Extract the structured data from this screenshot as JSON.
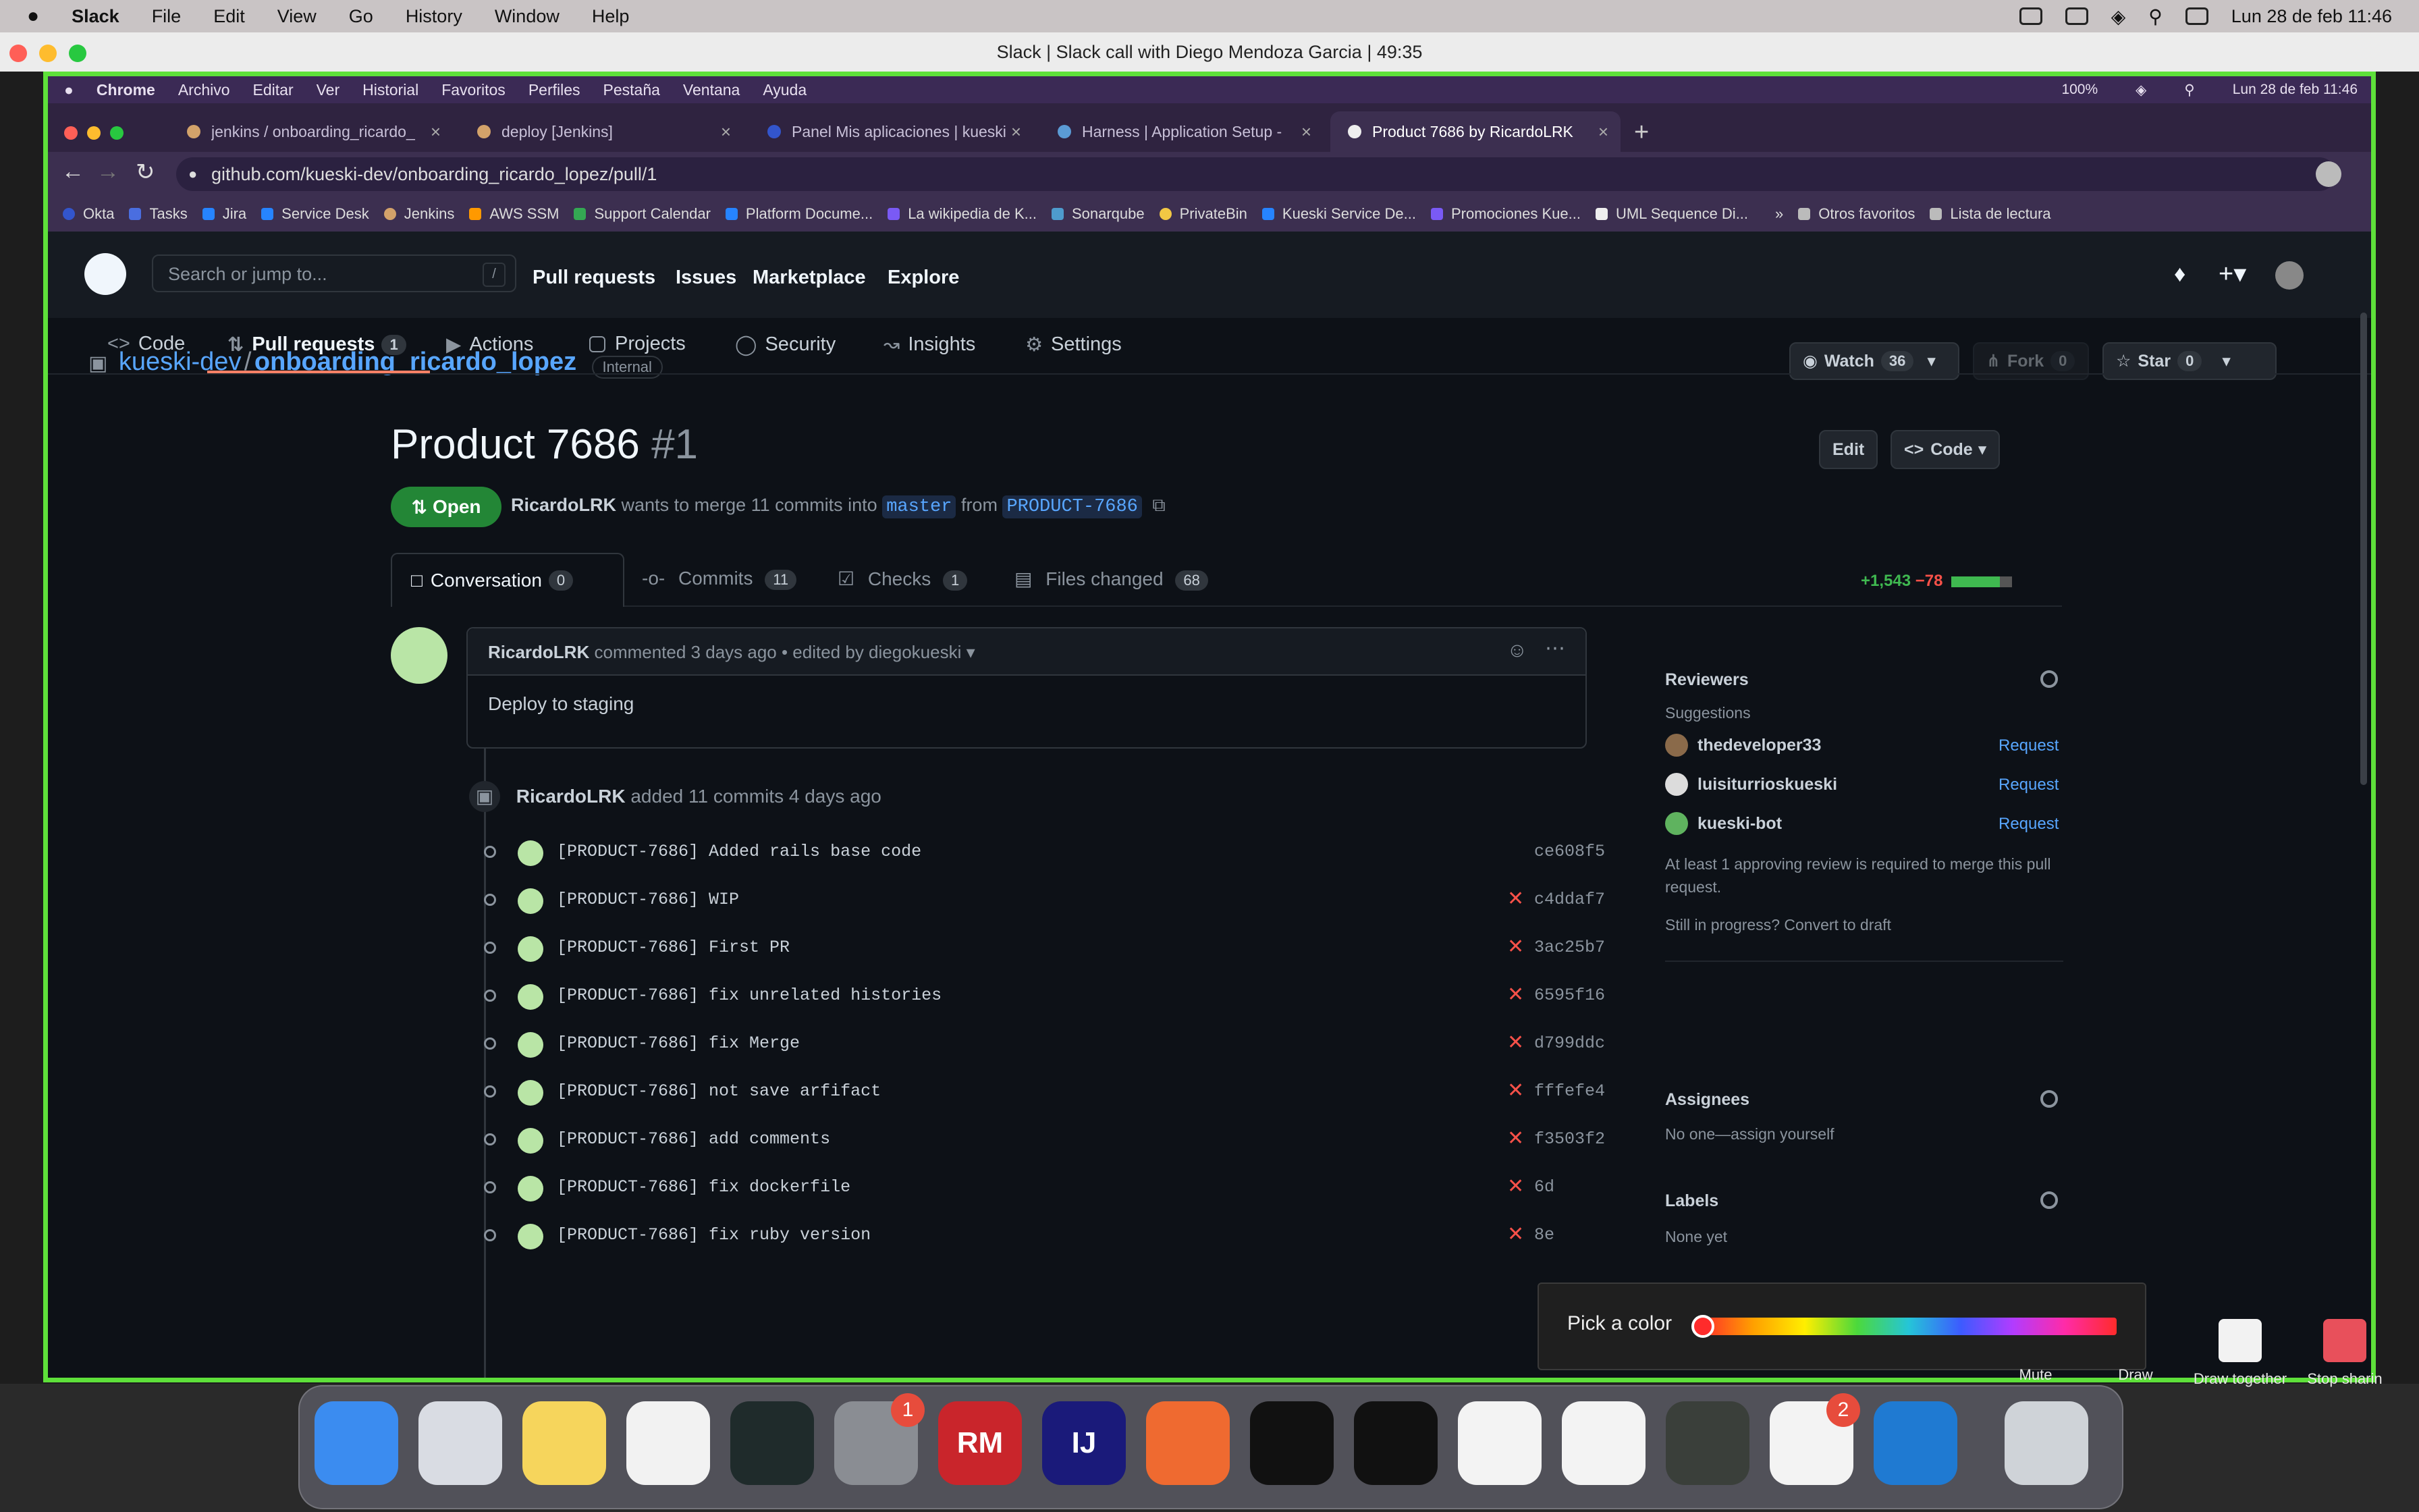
{
  "menubar": {
    "apple": "",
    "app": "Slack",
    "items": [
      "File",
      "Edit",
      "View",
      "Go",
      "History",
      "Window",
      "Help"
    ],
    "datetime": "Lun 28 de feb  11:46"
  },
  "slack": {
    "window_title": "Slack | Slack call with Diego Mendoza Garcia | 49:35"
  },
  "inner_menu": {
    "items": [
      "Chrome",
      "Archivo",
      "Editar",
      "Ver",
      "Historial",
      "Favoritos",
      "Perfiles",
      "Pestaña",
      "Ventana",
      "Ayuda"
    ],
    "battery": "100%",
    "datetime": "Lun 28 de feb  11:46"
  },
  "tabs": [
    {
      "label": "jenkins / onboarding_ricardo_"
    },
    {
      "label": "deploy [Jenkins]"
    },
    {
      "label": "Panel Mis aplicaciones | kueski"
    },
    {
      "label": "Harness | Application Setup - "
    },
    {
      "label": "Product 7686 by RicardoLRK"
    }
  ],
  "address": "github.com/kueski-dev/onboarding_ricardo_lopez/pull/1",
  "bookmarks": [
    "Okta",
    "Tasks",
    "Jira",
    "Service Desk",
    "Jenkins",
    "AWS SSM",
    "Support Calendar",
    "Platform Docume...",
    "La wikipedia de K...",
    "Sonarqube",
    "PrivateBin",
    "Kueski Service De...",
    "Promociones Kue...",
    "UML Sequence Di...",
    "»",
    "Otros favoritos",
    "Lista de lectura"
  ],
  "github": {
    "search_placeholder": "Search or jump to...",
    "search_key": "/",
    "nav": [
      "Pull requests",
      "Issues",
      "Marketplace",
      "Explore"
    ],
    "owner": "kueski-dev",
    "sep": "/",
    "repo": "onboarding_ricardo_lopez",
    "visibility": "Internal",
    "watch": {
      "label": "Watch",
      "count": "36"
    },
    "fork": {
      "label": "Fork",
      "count": "0"
    },
    "star": {
      "label": "Star",
      "count": "0"
    },
    "repo_tabs": [
      {
        "label": "Code"
      },
      {
        "label": "Pull requests",
        "count": "1"
      },
      {
        "label": "Actions"
      },
      {
        "label": "Projects"
      },
      {
        "label": "Security"
      },
      {
        "label": "Insights"
      },
      {
        "label": "Settings"
      }
    ]
  },
  "pr": {
    "title": "Product 7686",
    "number": "#1",
    "edit": "Edit",
    "code": "Code",
    "state": "Open",
    "author": "RicardoLRK",
    "merge_text": "wants to merge 11 commits into",
    "base": "master",
    "from": "from",
    "head": "PRODUCT-7686",
    "tabs": [
      {
        "label": "Conversation",
        "count": "0"
      },
      {
        "label": "Commits",
        "count": "11"
      },
      {
        "label": "Checks",
        "count": "1"
      },
      {
        "label": "Files changed",
        "count": "68"
      }
    ],
    "additions": "+1,543",
    "deletions": "−78",
    "comment": {
      "author": "RicardoLRK",
      "meta": "commented 3 days ago • edited by diegokueski",
      "body": "Deploy to staging"
    },
    "commits_event": {
      "author": "RicardoLRK",
      "text": "added 11 commits 4 days ago"
    },
    "commits": [
      {
        "msg": "[PRODUCT-7686] Added rails base code",
        "sha": "ce608f5",
        "failed": false
      },
      {
        "msg": "[PRODUCT-7686] WIP",
        "sha": "c4ddaf7",
        "failed": true
      },
      {
        "msg": "[PRODUCT-7686] First PR",
        "sha": "3ac25b7",
        "failed": true
      },
      {
        "msg": "[PRODUCT-7686] fix unrelated histories",
        "sha": "6595f16",
        "failed": true
      },
      {
        "msg": "[PRODUCT-7686] fix Merge",
        "sha": "d799ddc",
        "failed": true
      },
      {
        "msg": "[PRODUCT-7686] not save arfifact",
        "sha": "fffefe4",
        "failed": true
      },
      {
        "msg": "[PRODUCT-7686] add comments",
        "sha": "f3503f2",
        "failed": true
      },
      {
        "msg": "[PRODUCT-7686] fix dockerfile",
        "sha": "6d",
        "failed": true
      },
      {
        "msg": "[PRODUCT-7686] fix ruby version",
        "sha": "8e",
        "failed": true
      }
    ]
  },
  "sidebar": {
    "reviewers": "Reviewers",
    "suggestions": "Suggestions",
    "suggested": [
      {
        "name": "thedeveloper33",
        "action": "Request"
      },
      {
        "name": "luisiturrioskueski",
        "action": "Request"
      },
      {
        "name": "kueski-bot",
        "action": "Request"
      }
    ],
    "approval_note": "At least 1 approving review is required to merge this pull request.",
    "draft_note": "Still in progress? Convert to draft",
    "assignees": "Assignees",
    "assignees_value": "No one—assign yourself",
    "labels": "Labels",
    "labels_value": "None yet"
  },
  "call_controls": {
    "picker_label": "Pick a color",
    "mute": "Mute",
    "draw": "Draw",
    "draw_together": "Draw together",
    "stop_sharing": "Stop sharin"
  },
  "dock": {
    "apps": [
      {
        "name": "Finder",
        "color": "#3b8cf0"
      },
      {
        "name": "Launchpad",
        "color": "#d9dce3"
      },
      {
        "name": "Notes",
        "color": "#f6d55c"
      },
      {
        "name": "Reminders",
        "color": "#f2f2f2"
      },
      {
        "name": "Activity Monitor",
        "color": "#1f2b2b"
      },
      {
        "name": "System Preferences",
        "color": "#8a8d93",
        "badge": "1"
      },
      {
        "name": "RubyMine",
        "color": "#c9252b",
        "label": "RM"
      },
      {
        "name": "IntelliJ IDEA",
        "color": "#1a1a7a",
        "label": "IJ"
      },
      {
        "name": "Postman",
        "color": "#ef6a30"
      },
      {
        "name": "Terminal",
        "color": "#111111"
      },
      {
        "name": "iTerm",
        "color": "#111111"
      },
      {
        "name": "Brave",
        "color": "#f3f3f3"
      },
      {
        "name": "Chrome",
        "color": "#f3f3f3"
      },
      {
        "name": "Xcode-like",
        "color": "#3a3f3a"
      },
      {
        "name": "Slack",
        "color": "#f3f3f3",
        "badge": "2"
      },
      {
        "name": "VS Code",
        "color": "#1f7ad2"
      },
      {
        "name": "Trash",
        "color": "#cfd3d8"
      }
    ]
  }
}
